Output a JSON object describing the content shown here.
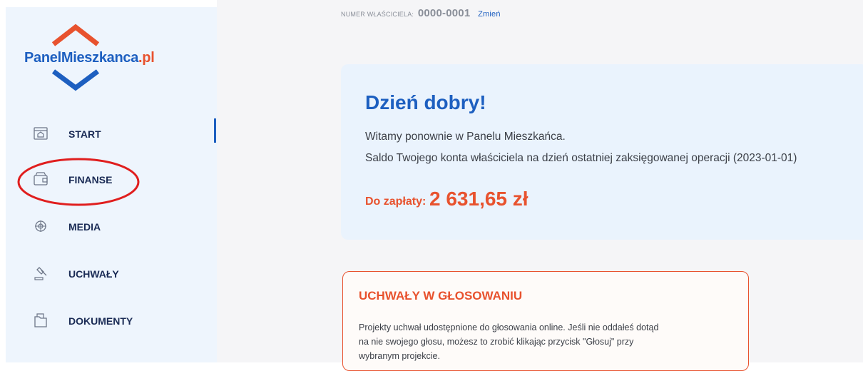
{
  "brand": {
    "name_part1": "PanelMieszkanca",
    "name_part2": ".pl"
  },
  "sidebar": {
    "items": [
      {
        "label": "START",
        "icon": "home-icon",
        "active": true
      },
      {
        "label": "FINANSE",
        "icon": "wallet-icon",
        "active": false
      },
      {
        "label": "MEDIA",
        "icon": "media-icon",
        "active": false
      },
      {
        "label": "UCHWAŁY",
        "icon": "gavel-icon",
        "active": false
      },
      {
        "label": "DOKUMENTY",
        "icon": "documents-icon",
        "active": false
      }
    ]
  },
  "header": {
    "owner_label": "NUMER WŁAŚCICIELA:",
    "owner_number": "0000-0001",
    "change_link": "Zmień"
  },
  "greeting": {
    "title": "Dzień dobry!",
    "line1": "Witamy ponownie w Panelu Mieszkańca.",
    "line2": "Saldo Twojego konta właściciela na dzień ostatniej zaksięgowanej operacji (2023-01-01)",
    "due_label": "Do zapłaty:",
    "due_amount": "2 631,65 zł"
  },
  "voting": {
    "title": "UCHWAŁY W GŁOSOWANIU",
    "text_lines": [
      "Projekty uchwał udostępnione do głosowania online. Jeśli nie oddałeś dotąd",
      "na nie swojego głosu, możesz to zrobić klikając przycisk \"Głosuj\" przy",
      "wybranym projekcie."
    ]
  },
  "colors": {
    "brand_blue": "#1d5fc0",
    "brand_orange": "#e8522e",
    "annotation_red": "#e01e1e",
    "sidebar_bg": "#eef5fd"
  }
}
